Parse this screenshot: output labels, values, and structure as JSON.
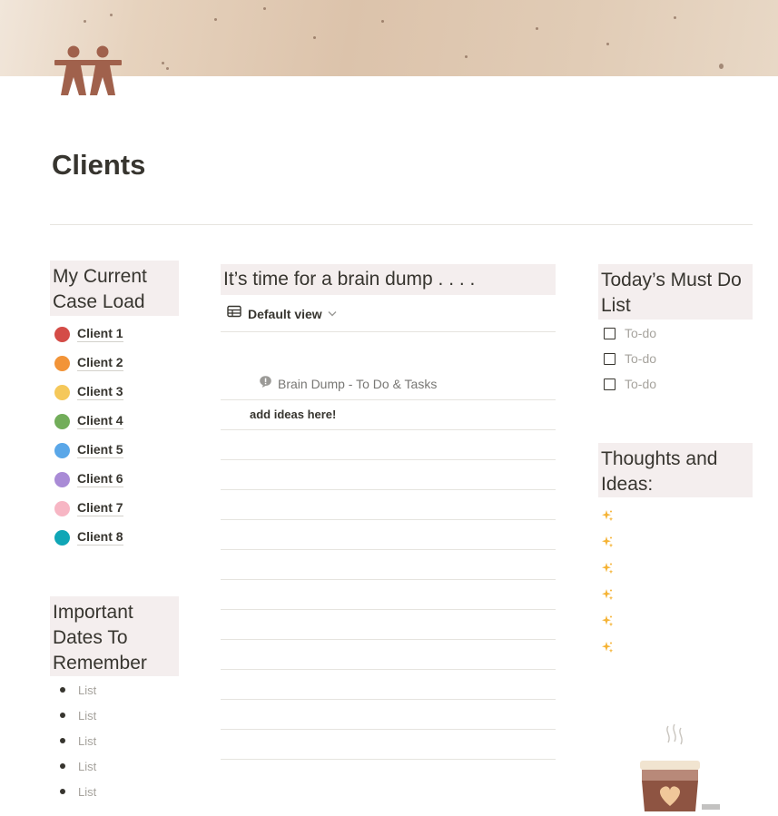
{
  "page": {
    "title": "Clients"
  },
  "left": {
    "caseload_heading": "My Current Case Load",
    "clients": [
      {
        "label": "Client 1",
        "color": "#d44c47"
      },
      {
        "label": "Client 2",
        "color": "#f29438"
      },
      {
        "label": "Client 3",
        "color": "#f5c85a"
      },
      {
        "label": "Client 4",
        "color": "#72ad5a"
      },
      {
        "label": "Client 5",
        "color": "#5aa7e8"
      },
      {
        "label": "Client 6",
        "color": "#a98bd6"
      },
      {
        "label": "Client 7",
        "color": "#f7b6c4"
      },
      {
        "label": "Client 8",
        "color": "#10a6b6"
      }
    ],
    "dates_heading": "Important Dates To Remember",
    "dates": [
      "List",
      "List",
      "List",
      "List",
      "List"
    ]
  },
  "middle": {
    "heading": "It’s time for a brain dump . . . .",
    "view_label": "Default view",
    "table_title": "Brain Dump - To Do & Tasks",
    "rows": [
      "add ideas here!"
    ]
  },
  "right": {
    "todo_heading": "Today’s Must Do List",
    "todos": [
      "To-do",
      "To-do",
      "To-do"
    ],
    "thoughts_heading": "Thoughts and Ideas:",
    "sparkles": [
      "✨",
      "✨",
      "✨",
      "✨",
      "✨",
      "✨"
    ]
  },
  "icons": {
    "page_icon": "two-people-icon",
    "view_icon": "table-icon",
    "header_icon": "comment-icon",
    "chevron": "chevron-down-icon",
    "decor": "coffee-cup-icon"
  },
  "colors": {
    "accent": "#a0614c",
    "callout_bg": "#f4eeee"
  }
}
